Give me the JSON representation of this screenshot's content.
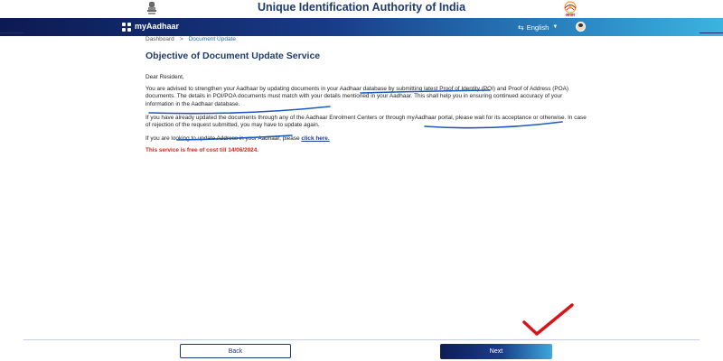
{
  "header": {
    "title": "Unique Identification Authority of India",
    "emblem_icon": "national-emblem-icon",
    "logo_icon": "aadhaar-logo-icon",
    "logo_text": "आधार"
  },
  "navbar": {
    "brand": "myAadhaar",
    "language": "English",
    "language_icon": "translate-icon",
    "user_icon": "avatar"
  },
  "breadcrumb": {
    "items": [
      "Dashboard",
      "Document Update"
    ],
    "separator": ">"
  },
  "main": {
    "heading": "Objective of Document Update Service",
    "greeting": "Dear Resident,",
    "para1": "You are advised to strengthen your Aadhaar by updating documents in your Aadhaar database by submitting latest Proof of Identity (POI) and Proof of Address (POA) documents. The details in POI/POA documents must match with your details mentioned in your Aadhaar. This shall help you in ensuring continued accuracy of your information in the Aadhaar database.",
    "para2": "If you have already updated the documents through any of the Aadhaar Enrolment Centers or through myAadhaar portal, please wait for its acceptance or otherwise. In case of rejection of the request submitted, you may have to update again.",
    "para3_prefix": "If you are looking to update Address in your Aadhaar, please",
    "para3_link": "click here.",
    "free_note": "This service is free of cost till 14/06/2024."
  },
  "footer": {
    "back_label": "Back",
    "next_label": "Next"
  },
  "colors": {
    "title": "#1f3b6e",
    "note": "#e0201a",
    "annotation_blue": "#1a5bbf",
    "annotation_red": "#d8141a"
  }
}
